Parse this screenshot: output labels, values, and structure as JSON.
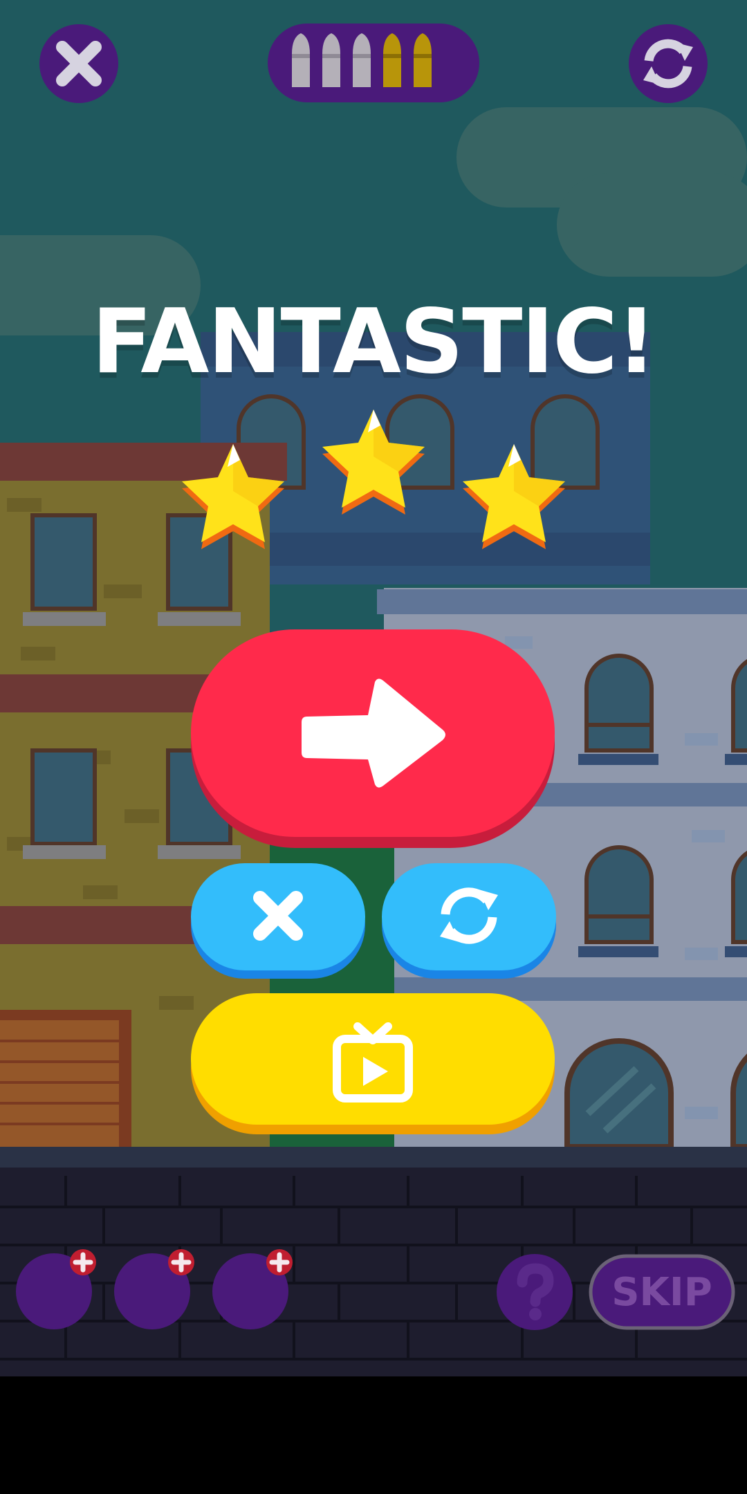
{
  "result": {
    "title": "FANTASTIC!",
    "stars_earned": 3,
    "stars_total": 3
  },
  "hud": {
    "close_icon": "close-icon",
    "restart_icon": "restart-icon",
    "ammo": {
      "total": 5,
      "used": 3,
      "remaining": 2
    }
  },
  "buttons": {
    "next": {
      "icon": "arrow-right-icon",
      "color": "#ff2a4b"
    },
    "exit": {
      "icon": "close-icon",
      "color": "#33bdfb"
    },
    "replay": {
      "icon": "restart-icon",
      "color": "#33bdfb"
    },
    "watch_ad": {
      "icon": "tv-play-icon",
      "color": "#ffdd00"
    }
  },
  "bottom_bar": {
    "powerup_slots": 3,
    "help_icon": "question-icon",
    "skip_label": "SKIP"
  },
  "colors": {
    "sky": "#236266",
    "hud_purple": "#4a1a7a",
    "star": "#ffe21a",
    "star_edge": "#f06a12",
    "ground": "#1e1d2e"
  }
}
